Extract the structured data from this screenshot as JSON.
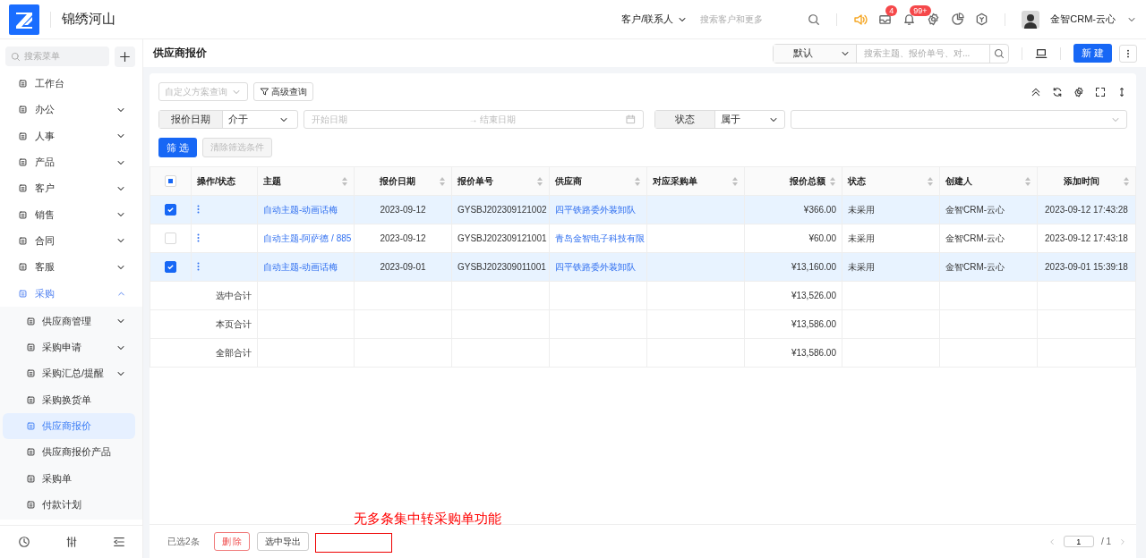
{
  "header": {
    "app_name": "锦绣河山",
    "search_scope": "客户/联系人",
    "search_placeholder": "搜索客户和更多",
    "badges": [
      {
        "count": "4"
      },
      {
        "count": "99+"
      }
    ],
    "user": "金智CRM-云心"
  },
  "sidebar": {
    "search_placeholder": "搜索菜单",
    "items": [
      {
        "label": "工作台",
        "expandable": false,
        "expanded": false
      },
      {
        "label": "办公",
        "expandable": true,
        "expanded": false
      },
      {
        "label": "人事",
        "expandable": true,
        "expanded": false
      },
      {
        "label": "产品",
        "expandable": true,
        "expanded": false
      },
      {
        "label": "客户",
        "expandable": true,
        "expanded": false
      },
      {
        "label": "销售",
        "expandable": true,
        "expanded": false
      },
      {
        "label": "合同",
        "expandable": true,
        "expanded": false
      },
      {
        "label": "客服",
        "expandable": true,
        "expanded": false
      },
      {
        "label": "采购",
        "expandable": true,
        "expanded": true,
        "children": [
          {
            "label": "供应商管理",
            "expandable": true,
            "selected": false
          },
          {
            "label": "采购申请",
            "expandable": true,
            "selected": false
          },
          {
            "label": "采购汇总/提醒",
            "expandable": true,
            "selected": false
          },
          {
            "label": "采购换货单",
            "expandable": false,
            "selected": false
          },
          {
            "label": "供应商报价",
            "expandable": false,
            "selected": true
          },
          {
            "label": "供应商报价产品",
            "expandable": false,
            "selected": false
          },
          {
            "label": "采购单",
            "expandable": false,
            "selected": false
          },
          {
            "label": "付款计划",
            "expandable": false,
            "selected": false
          }
        ]
      }
    ]
  },
  "page": {
    "title": "供应商报价",
    "view": "默认",
    "search_placeholder": "搜索主题、报价单号、对...",
    "new_button": "新 建"
  },
  "filters": {
    "scheme_placeholder": "自定义方案查询",
    "advanced": "高级查询",
    "date_label": "报价日期",
    "date_op": "介于",
    "start_placeholder": "开始日期",
    "range_separator": "→",
    "end_placeholder": "结束日期",
    "status_label": "状态",
    "status_op": "属于",
    "filter_button": "筛 选",
    "clear_button": "清除筛选条件"
  },
  "table": {
    "indeterminate": true,
    "columns": [
      {
        "label": "操作/状态",
        "sortable": false
      },
      {
        "label": "主题",
        "sortable": true
      },
      {
        "label": "报价日期",
        "sortable": true
      },
      {
        "label": "报价单号",
        "sortable": true
      },
      {
        "label": "供应商",
        "sortable": true
      },
      {
        "label": "对应采购单",
        "sortable": true
      },
      {
        "label": "报价总额",
        "sortable": true
      },
      {
        "label": "状态",
        "sortable": true
      },
      {
        "label": "创建人",
        "sortable": true
      },
      {
        "label": "添加时间",
        "sortable": true
      }
    ],
    "rows": [
      {
        "selected": true,
        "subject": "自动主题-动画话梅",
        "date": "2023-09-12",
        "number": "GYSBJ202309121002",
        "supplier": "四平铁路委外装卸队",
        "amount": "¥366.00",
        "status": "未采用",
        "creator": "金智CRM-云心",
        "time": "2023-09-12 17:43:28"
      },
      {
        "selected": false,
        "subject": "自动主题-阿萨德 / 885",
        "date": "2023-09-12",
        "number": "GYSBJ202309121001",
        "supplier": "青岛金智电子科技有限",
        "amount": "¥60.00",
        "status": "未采用",
        "creator": "金智CRM-云心",
        "time": "2023-09-12 17:43:18"
      },
      {
        "selected": true,
        "subject": "自动主题-动画话梅",
        "date": "2023-09-01",
        "number": "GYSBJ202309011001",
        "supplier": "四平铁路委外装卸队",
        "amount": "¥13,160.00",
        "status": "未采用",
        "creator": "金智CRM-云心",
        "time": "2023-09-01 15:39:18"
      }
    ],
    "summaries": [
      {
        "label": "选中合计",
        "amount": "¥13,526.00"
      },
      {
        "label": "本页合计",
        "amount": "¥13,586.00"
      },
      {
        "label": "全部合计",
        "amount": "¥13,586.00"
      }
    ]
  },
  "footer": {
    "selected_count": "已选2条",
    "delete": "删 除",
    "export": "选中导出",
    "page": "1",
    "total": "/ 1"
  },
  "annotation": {
    "text": "无多条集中转采购单功能"
  }
}
